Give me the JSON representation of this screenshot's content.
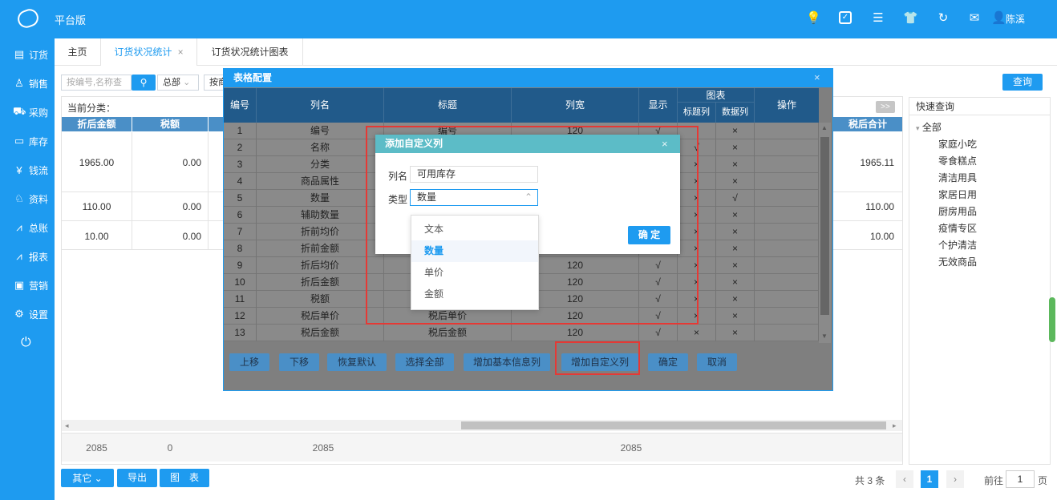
{
  "app": {
    "title": "平台版",
    "user": "陈溪"
  },
  "header_icons": [
    "bulb-icon",
    "check-square-icon",
    "menu-icon",
    "shirt-icon",
    "refresh-icon",
    "mail-icon",
    "user-icon"
  ],
  "sidebar": {
    "items": [
      {
        "label": "订货",
        "icon": "document-icon"
      },
      {
        "label": "销售",
        "icon": "user-icon"
      },
      {
        "label": "采购",
        "icon": "cart-icon"
      },
      {
        "label": "库存",
        "icon": "inventory-icon"
      },
      {
        "label": "钱流",
        "icon": "money-icon"
      },
      {
        "label": "资料",
        "icon": "contacts-icon"
      },
      {
        "label": "总账",
        "icon": "ledger-chart-icon"
      },
      {
        "label": "报表",
        "icon": "report-chart-icon"
      },
      {
        "label": "营销",
        "icon": "marketing-icon"
      },
      {
        "label": "设置",
        "icon": "gear-icon"
      },
      {
        "label": "",
        "icon": "power-icon"
      }
    ]
  },
  "tabs": [
    {
      "label": "主页"
    },
    {
      "label": "订货状况统计",
      "close": "×"
    },
    {
      "label": "订货状况统计图表"
    }
  ],
  "toolbar": {
    "search_placeholder": "按编号,名称查",
    "select1": "总部",
    "select2": "按商",
    "query": "查询"
  },
  "main": {
    "current_category_label": "当前分类：",
    "expand": ">>",
    "columns": [
      "折后金额",
      "税额"
    ],
    "right_column": "税后合计",
    "rows": [
      {
        "amount": "1965.00",
        "tax": "0.00",
        "total": "1965.11"
      },
      {
        "amount": "110.00",
        "tax": "0.00",
        "total": "110.00"
      },
      {
        "amount": "10.00",
        "tax": "0.00",
        "total": "10.00"
      }
    ],
    "footer": [
      "2085",
      "0",
      "2085",
      "2085"
    ]
  },
  "quick": {
    "title": "快速查询",
    "root": "全部",
    "items": [
      "家庭小吃",
      "零食糕点",
      "清洁用具",
      "家居日用",
      "厨房用品",
      "疫情专区",
      "个护清洁",
      "无效商品"
    ]
  },
  "bottom": {
    "other": "其它",
    "export": "导出",
    "chart": "图　表",
    "total": "共 3 条",
    "page": "1",
    "goto": "前往",
    "goto_page": "1",
    "page_unit": "页"
  },
  "dialog": {
    "title": "表格配置",
    "close": "×",
    "headers": {
      "no": "编号",
      "name": "列名",
      "title": "标题",
      "width": "列宽",
      "show": "显示",
      "chart": "图表",
      "chart_title": "标题列",
      "chart_data": "数据列",
      "ops": "操作"
    },
    "rows": [
      {
        "no": "1",
        "name": "编号",
        "title": "编号",
        "width": "120",
        "show": "√",
        "ct": "",
        "cd": "×"
      },
      {
        "no": "2",
        "name": "名称",
        "title": "",
        "width": "",
        "show": "",
        "ct": "√",
        "cd": "×"
      },
      {
        "no": "3",
        "name": "分类",
        "title": "",
        "width": "",
        "show": "",
        "ct": "×",
        "cd": "×"
      },
      {
        "no": "4",
        "name": "商品属性",
        "title": "",
        "width": "",
        "show": "",
        "ct": "×",
        "cd": "×"
      },
      {
        "no": "5",
        "name": "数量",
        "title": "",
        "width": "",
        "show": "",
        "ct": "×",
        "cd": "√"
      },
      {
        "no": "6",
        "name": "辅助数量",
        "title": "",
        "width": "",
        "show": "",
        "ct": "×",
        "cd": "×"
      },
      {
        "no": "7",
        "name": "折前均价",
        "title": "",
        "width": "",
        "show": "",
        "ct": "×",
        "cd": "×"
      },
      {
        "no": "8",
        "name": "折前金额",
        "title": "",
        "width": "",
        "show": "",
        "ct": "×",
        "cd": "×"
      },
      {
        "no": "9",
        "name": "折后均价",
        "title": "",
        "width": "120",
        "show": "√",
        "ct": "×",
        "cd": "×"
      },
      {
        "no": "10",
        "name": "折后金额",
        "title": "",
        "width": "120",
        "show": "√",
        "ct": "×",
        "cd": "×"
      },
      {
        "no": "11",
        "name": "税额",
        "title": "",
        "width": "120",
        "show": "√",
        "ct": "×",
        "cd": "×"
      },
      {
        "no": "12",
        "name": "税后单价",
        "title": "税后单价",
        "width": "120",
        "show": "√",
        "ct": "×",
        "cd": "×"
      },
      {
        "no": "13",
        "name": "税后金额",
        "title": "税后金额",
        "width": "120",
        "show": "√",
        "ct": "×",
        "cd": "×"
      }
    ],
    "buttons": [
      "上移",
      "下移",
      "恢复默认",
      "选择全部",
      "增加基本信息列",
      "增加自定义列",
      "确定",
      "取消"
    ]
  },
  "subdialog": {
    "title": "添加自定义列",
    "close": "×",
    "name_label": "列名",
    "name_value": "可用库存",
    "type_label": "类型",
    "type_value": "数量",
    "ok": "确 定",
    "options": [
      "文本",
      "数量",
      "单价",
      "金额"
    ]
  }
}
